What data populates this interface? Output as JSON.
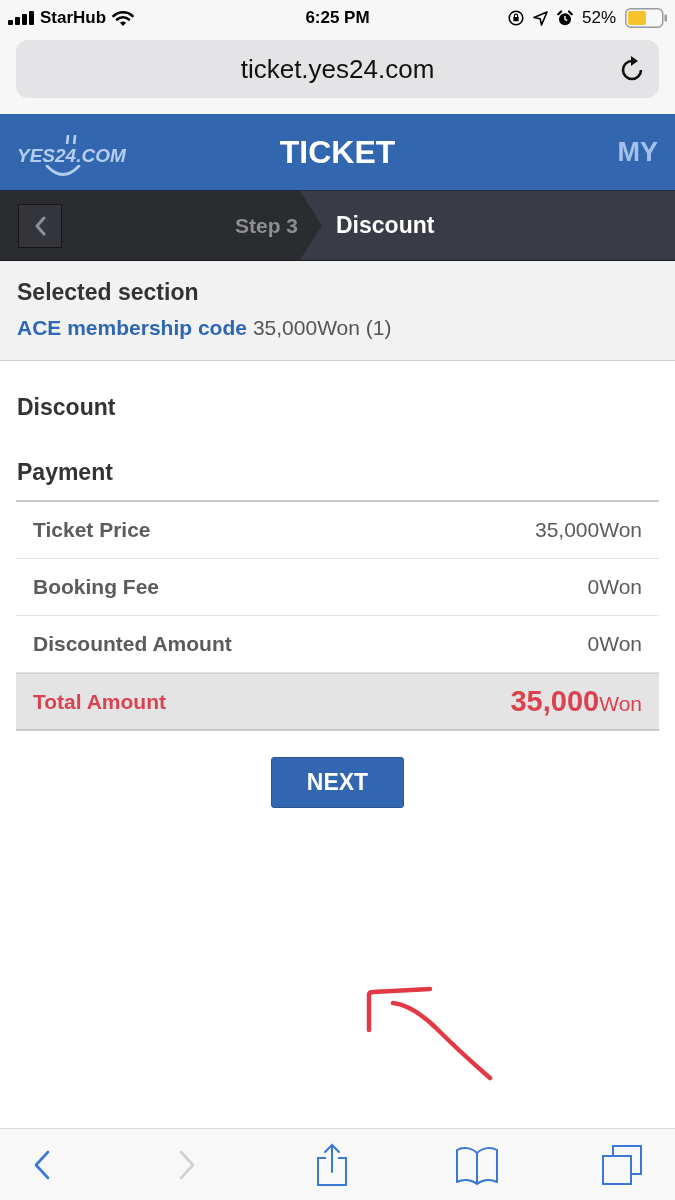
{
  "status_bar": {
    "carrier": "StarHub",
    "time": "6:25 PM",
    "battery": "52%"
  },
  "address_bar": {
    "url": "ticket.yes24.com"
  },
  "header": {
    "logo": "YES24.COM",
    "title": "TICKET",
    "my_link": "MY"
  },
  "steps": {
    "previous": "Step 3",
    "current": "Discount"
  },
  "selected_section": {
    "heading": "Selected section",
    "item": "ACE membership code",
    "detail": "35,000Won (1)"
  },
  "discount": {
    "heading": "Discount"
  },
  "payment": {
    "heading": "Payment",
    "rows": [
      {
        "kind": "line",
        "label": "Ticket Price",
        "value": "35,000Won"
      },
      {
        "kind": "line",
        "label": "Booking Fee",
        "value": "0Won"
      },
      {
        "kind": "line",
        "label": "Discounted Amount",
        "value": "0Won"
      },
      {
        "kind": "total",
        "label": "Total Amount",
        "value": "**35,000**Won"
      }
    ]
  },
  "next_button": "NEXT",
  "toolbar": [
    {
      "kind": "back",
      "disabled": false
    },
    {
      "kind": "forward",
      "disabled": true
    },
    {
      "kind": "share",
      "disabled": false
    },
    {
      "kind": "bookmarks",
      "disabled": false
    },
    {
      "kind": "tabs",
      "disabled": false
    }
  ]
}
